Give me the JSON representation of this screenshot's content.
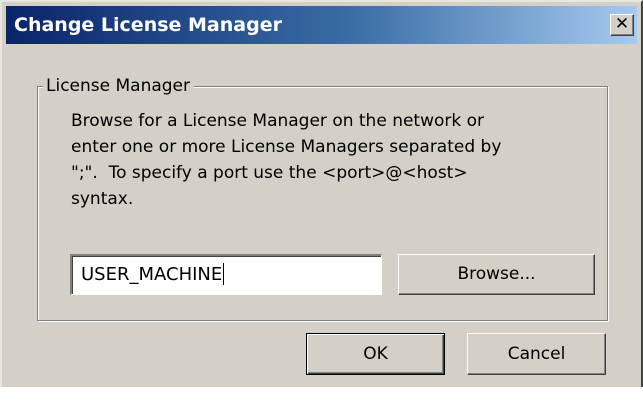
{
  "dialog": {
    "title": "Change License Manager",
    "close_glyph": "✕"
  },
  "group": {
    "legend": "License Manager",
    "description_lines": [
      "Browse for a License Manager on the network or",
      "enter one or more License Managers separated by",
      "\";\".  To specify a port use the <port>@<host>",
      "syntax."
    ]
  },
  "license_field": {
    "value": "USER_MACHINE"
  },
  "buttons": {
    "browse_label": "Browse...",
    "ok_label": "OK",
    "cancel_label": "Cancel"
  },
  "colors": {
    "titlebar_start": "#0a246a",
    "titlebar_end": "#a6caf0",
    "dialog_face": "#d4d0c8"
  }
}
